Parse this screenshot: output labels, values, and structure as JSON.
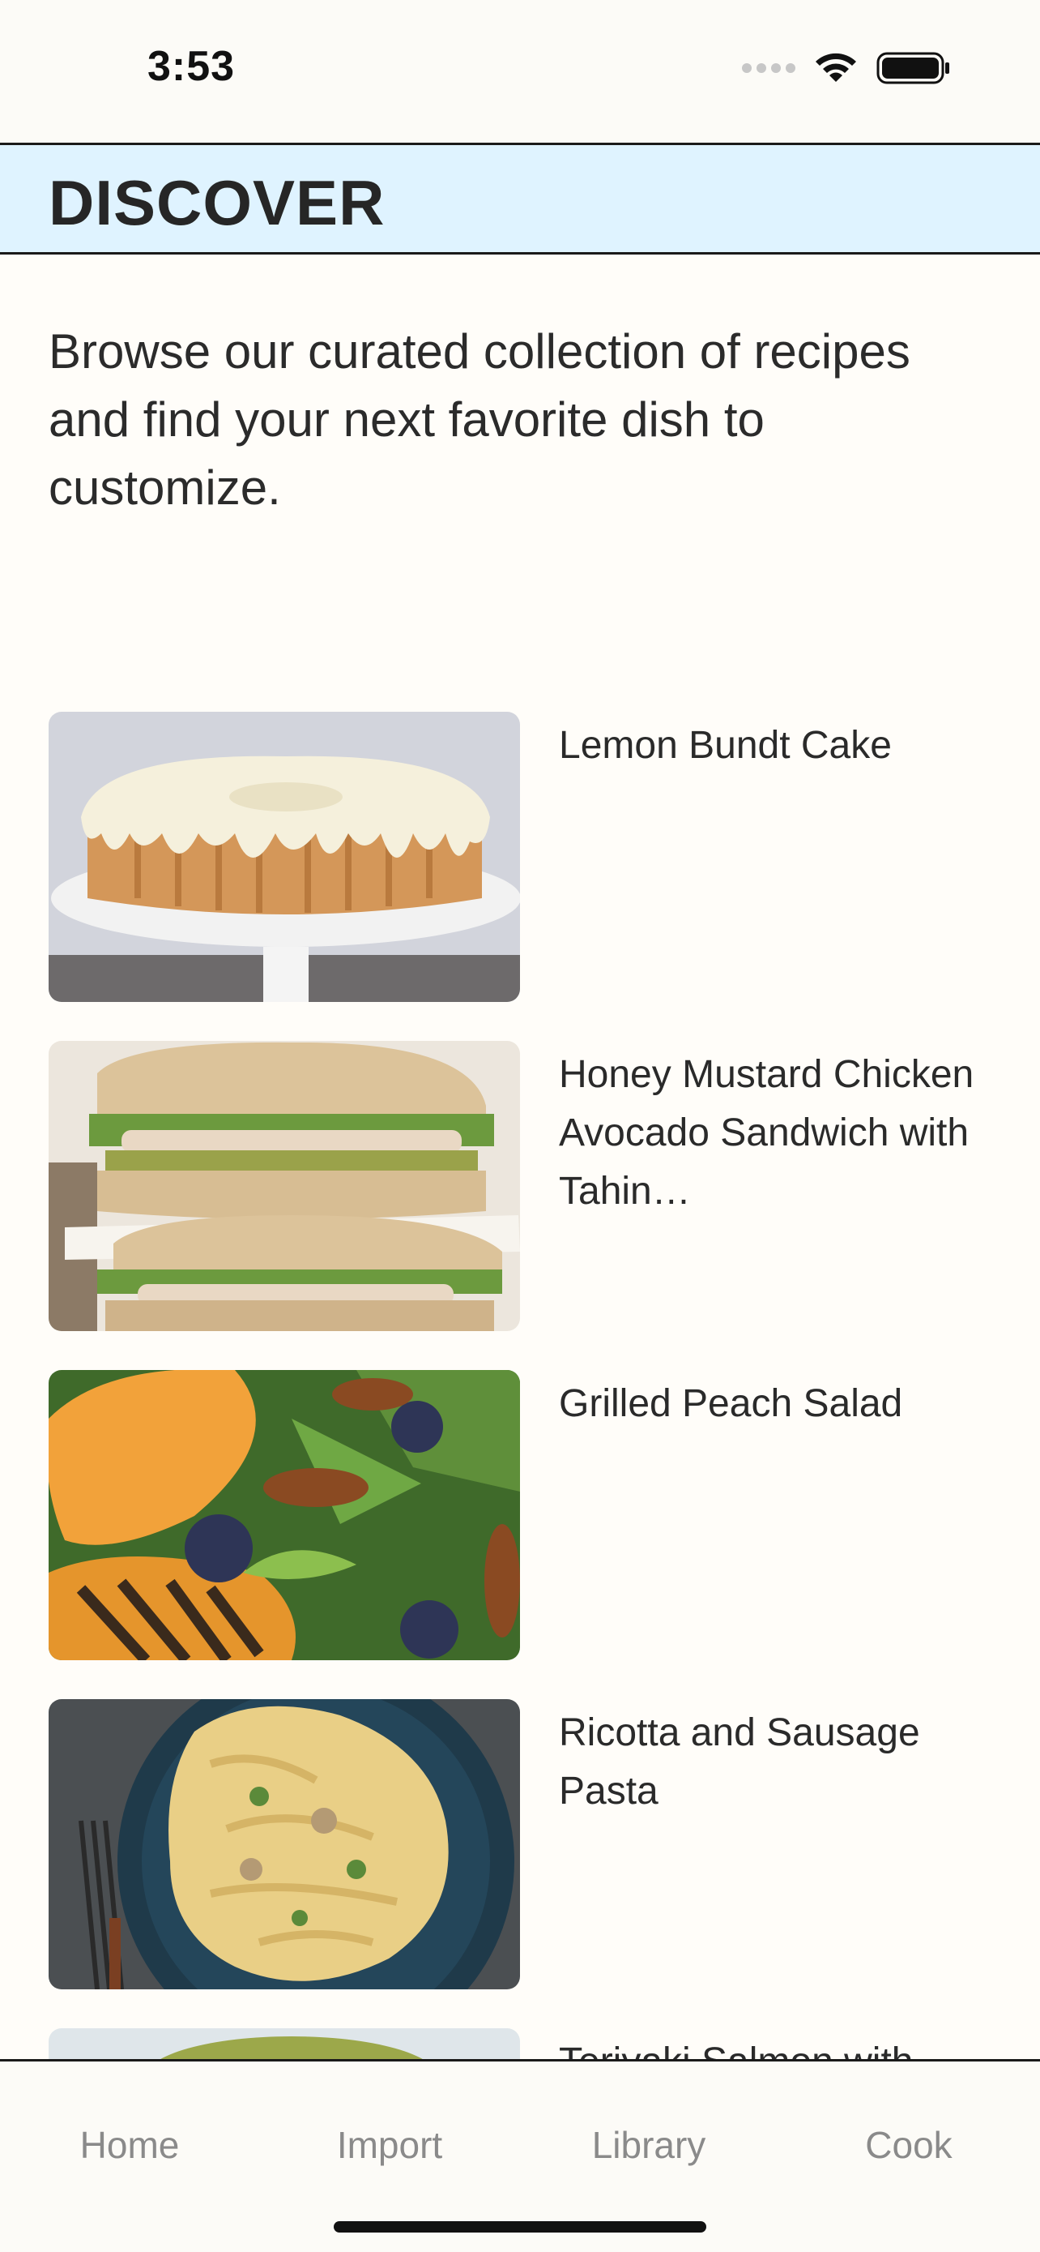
{
  "status": {
    "time": "3:53"
  },
  "header": {
    "title": "DISCOVER"
  },
  "intro": "Browse our curated collection of recipes and find your next favorite dish to customize.",
  "recipes": [
    {
      "title": "Lemon Bundt Cake",
      "image": "lemon-bundt-cake-photo"
    },
    {
      "title": "Honey Mustard Chicken Avocado Sandwich with Tahin…",
      "image": "chicken-sandwich-photo"
    },
    {
      "title": "Grilled Peach Salad",
      "image": "grilled-peach-salad-photo"
    },
    {
      "title": "Ricotta and Sausage Pasta",
      "image": "sausage-pasta-photo"
    },
    {
      "title": "Teriyaki Salmon with",
      "image": "teriyaki-salmon-photo"
    }
  ],
  "tabs": [
    "Home",
    "Import",
    "Library",
    "Cook"
  ],
  "colors": {
    "header_bg": "#dff3ff",
    "background": "#fffdf9",
    "tab_inactive": "#8a8a8a"
  }
}
